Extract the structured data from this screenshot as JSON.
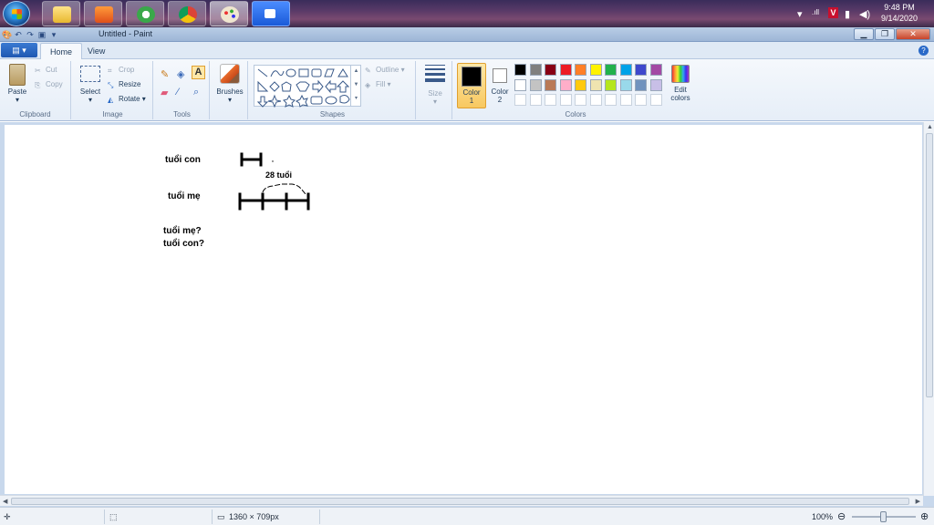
{
  "taskbar": {
    "clock_time": "9:48 PM",
    "clock_date": "9/14/2020",
    "apps": [
      "file-explorer",
      "media-player",
      "app-launcher",
      "chrome",
      "paint",
      "zoom"
    ]
  },
  "window": {
    "title": "Untitled - Paint"
  },
  "tabs": {
    "home": "Home",
    "view": "View"
  },
  "ribbon": {
    "clipboard": {
      "paste": "Paste",
      "cut": "Cut",
      "copy": "Copy",
      "group": "Clipboard"
    },
    "image": {
      "select": "Select",
      "crop": "Crop",
      "resize": "Resize",
      "rotate": "Rotate",
      "group": "Image"
    },
    "tools": {
      "group": "Tools"
    },
    "brushes": {
      "label": "Brushes"
    },
    "shapes": {
      "outline": "Outline",
      "fill": "Fill",
      "group": "Shapes"
    },
    "size": {
      "label": "Size"
    },
    "colors": {
      "color1_line1": "Color",
      "color1_line2": "1",
      "color2_line1": "Color",
      "color2_line2": "2",
      "edit_line1": "Edit",
      "edit_line2": "colors",
      "group": "Colors",
      "color1_value": "#000000",
      "color2_value": "#ffffff",
      "palette_row1": [
        "#000000",
        "#7f7f7f",
        "#880015",
        "#ed1c24",
        "#ff7f27",
        "#fff200",
        "#22b14c",
        "#00a2e8",
        "#3f48cc",
        "#a349a4"
      ],
      "palette_row2": [
        "#ffffff",
        "#c3c3c3",
        "#b97a57",
        "#ffaec9",
        "#ffc90e",
        "#efe4b0",
        "#b5e61d",
        "#99d9ea",
        "#7092be",
        "#c8bfe7"
      ]
    }
  },
  "canvas": {
    "label_child_age": "tuổi con",
    "label_mother_age": "tuổi mẹ",
    "label_difference": "28 tuổi",
    "question_mother": "tuổi mẹ?",
    "question_child": "tuổi con?"
  },
  "statusbar": {
    "dimensions": "1360 × 709px",
    "zoom": "100%"
  }
}
